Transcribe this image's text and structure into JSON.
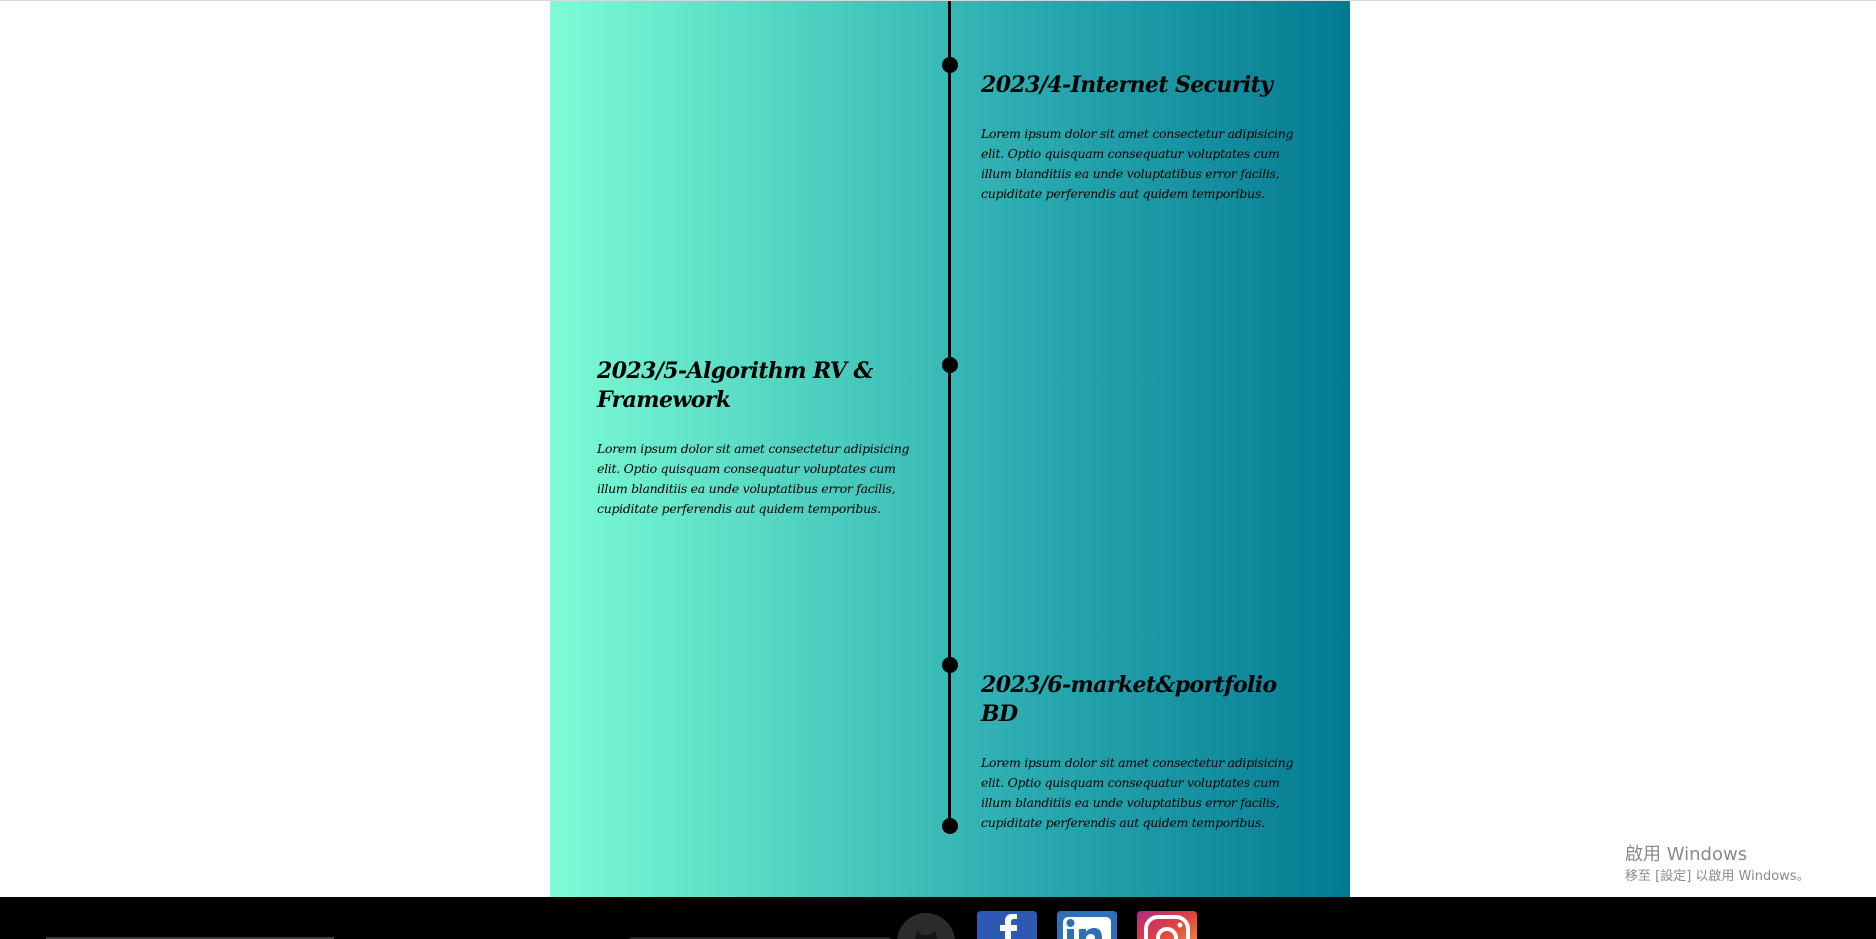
{
  "timeline": {
    "entries": [
      {
        "title": "2023/4-Internet Security",
        "body": "Lorem ipsum dolor sit amet consectetur adipisicing elit. Optio quisquam consequatur voluptates cum illum blanditiis ea unde voluptatibus error facilis, cupiditate perferendis aut quidem temporibus."
      },
      {
        "title": "2023/5-Algorithm RV & Framework",
        "body": "Lorem ipsum dolor sit amet consectetur adipisicing elit. Optio quisquam consequatur voluptates cum illum blanditiis ea unde voluptatibus error facilis, cupiditate perferendis aut quidem temporibus."
      },
      {
        "title": "2023/6-market&portfolio BD",
        "body": "Lorem ipsum dolor sit amet consectetur adipisicing elit. Optio quisquam consequatur voluptates cum illum blanditiis ea unde voluptatibus error facilis, cupiditate perferendis aut quidem temporibus."
      }
    ],
    "gradient": [
      "#7dfcd6",
      "#037a92"
    ]
  },
  "footer": {
    "background": "#000000",
    "social_icons": [
      "github-icon",
      "facebook-icon",
      "linkedin-icon",
      "instagram-icon"
    ]
  },
  "watermark": {
    "line1": "啟用 Windows",
    "line2": "移至 [設定] 以啟用 Windows。"
  }
}
